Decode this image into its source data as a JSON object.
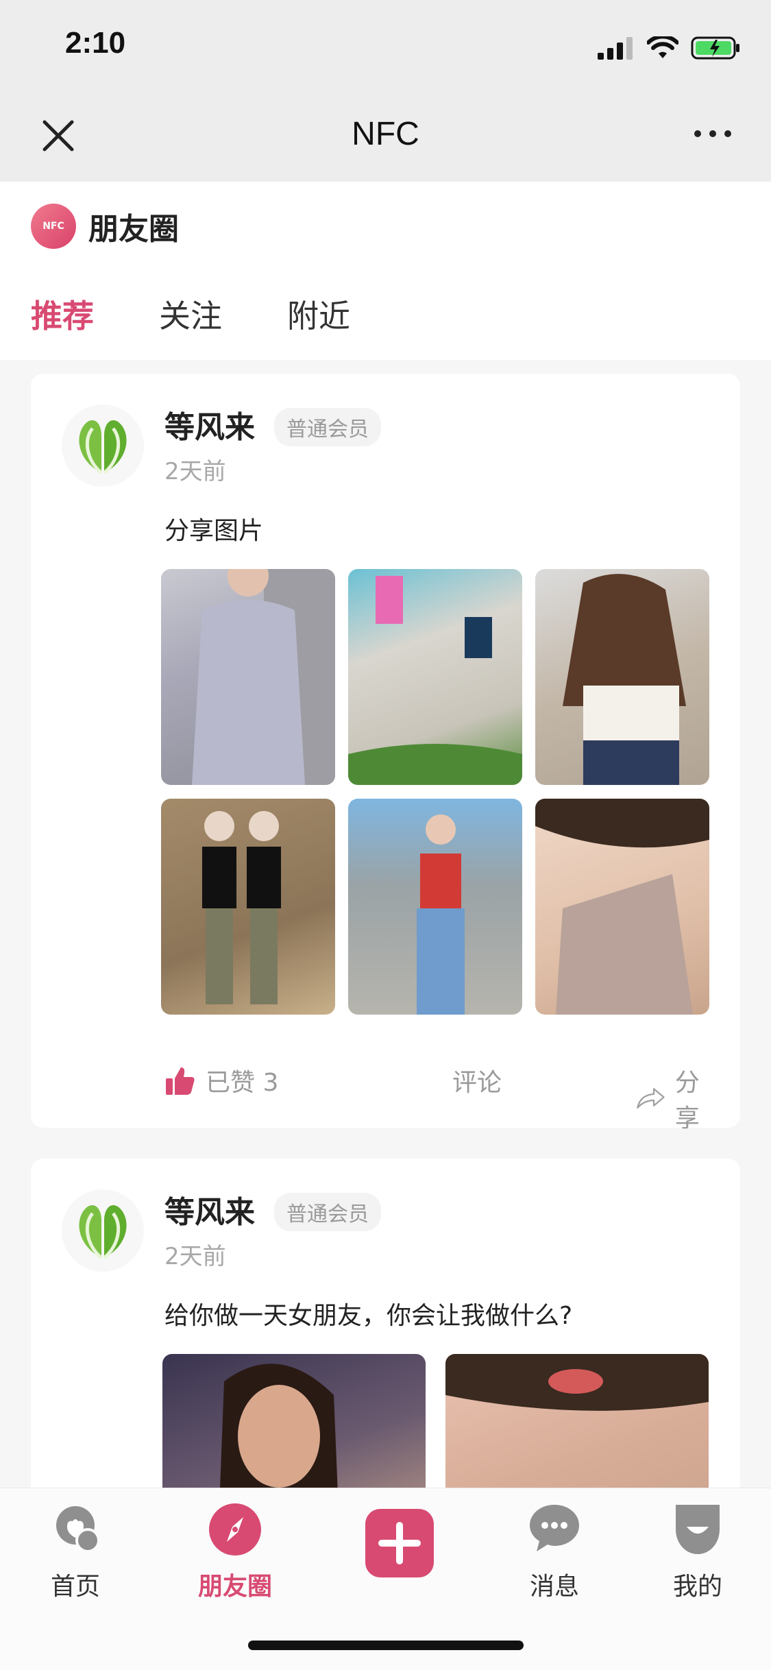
{
  "status_bar": {
    "time": "2:10"
  },
  "nav": {
    "title": "NFC"
  },
  "brand": {
    "logo_text": "NFC",
    "title": "朋友圈"
  },
  "tabs": [
    {
      "label": "推荐",
      "active": true
    },
    {
      "label": "关注",
      "active": false
    },
    {
      "label": "附近",
      "active": false
    }
  ],
  "posts": [
    {
      "username": "等风来",
      "badge": "普通会员",
      "time": "2天前",
      "text": "分享图片",
      "photo_count": 6,
      "like_label": "已赞 3",
      "comment_label": "评论",
      "share_label": "分享"
    },
    {
      "username": "等风来",
      "badge": "普通会员",
      "time": "2天前",
      "text": "给你做一天女朋友，你会让我做什么?",
      "photo_count": 2
    }
  ],
  "tabbar": {
    "items": [
      {
        "label": "首页",
        "icon": "home-icon",
        "active": false
      },
      {
        "label": "朋友圈",
        "icon": "compass-icon",
        "active": true
      },
      {
        "label": "",
        "icon": "plus-icon",
        "active": false
      },
      {
        "label": "消息",
        "icon": "chat-icon",
        "active": false
      },
      {
        "label": "我的",
        "icon": "profile-icon",
        "active": false
      }
    ]
  },
  "colors": {
    "accent": "#d84a72",
    "text": "#222222",
    "muted": "#a8a8a8"
  }
}
